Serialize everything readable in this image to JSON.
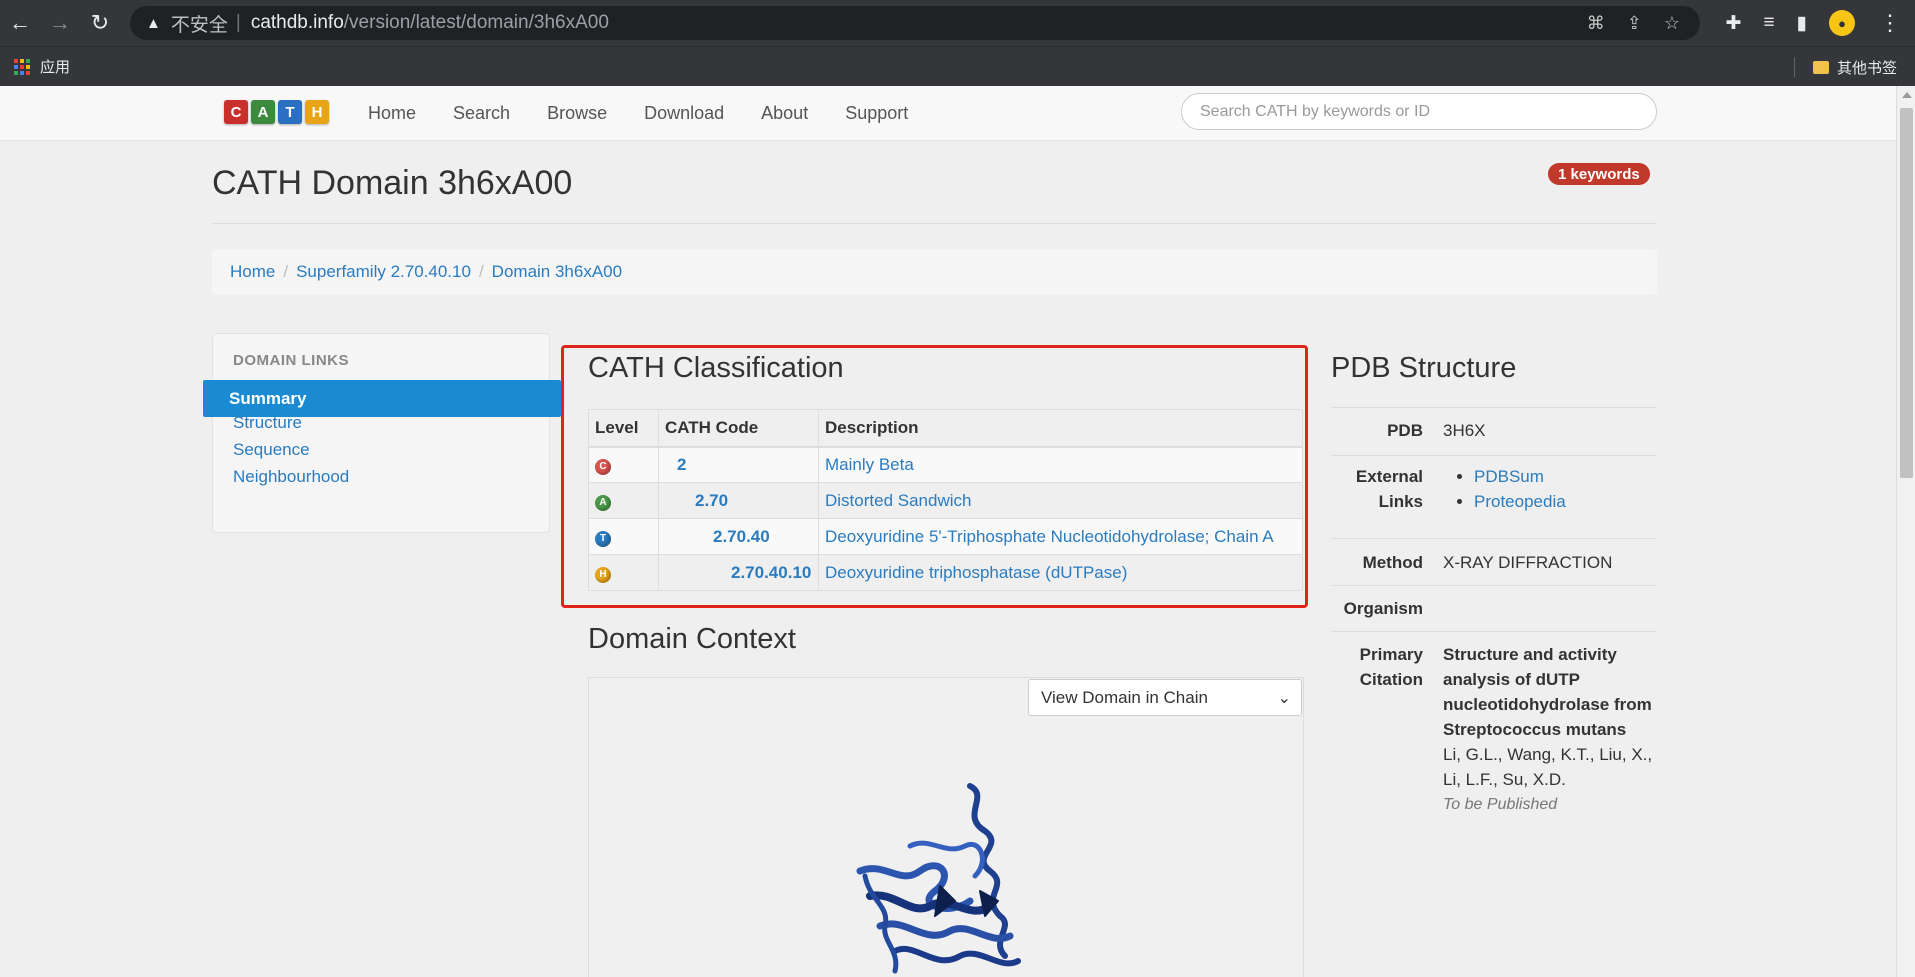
{
  "browser": {
    "security_label": "不安全",
    "url_host": "cathdb.info",
    "url_path": "/version/latest/domain/3h6xA00",
    "bookmarks_apps": "应用",
    "bookmarks_other": "其他书签"
  },
  "site": {
    "logo_letters": [
      "C",
      "A",
      "T",
      "H"
    ],
    "logo_colors": [
      "#c9302c",
      "#3c8a3c",
      "#2a6fc0",
      "#e8a319"
    ],
    "nav": [
      "Home",
      "Search",
      "Browse",
      "Download",
      "About",
      "Support"
    ],
    "search_placeholder": "Search CATH by keywords or ID"
  },
  "page": {
    "title": "CATH Domain 3h6xA00",
    "keywords_badge": "1 keywords"
  },
  "breadcrumb": [
    "Home",
    "Superfamily 2.70.40.10",
    "Domain 3h6xA00"
  ],
  "sidebar": {
    "heading": "DOMAIN LINKS",
    "active": "Summary",
    "links": [
      "Structure",
      "Sequence",
      "Neighbourhood"
    ]
  },
  "classification": {
    "title": "CATH Classification",
    "headers": [
      "Level",
      "CATH Code",
      "Description"
    ],
    "rows": [
      {
        "level": "C",
        "level_color": "#d9534f",
        "code": "2",
        "description": "Mainly Beta"
      },
      {
        "level": "A",
        "level_color": "#4a9a4a",
        "code": "2.70",
        "description": "Distorted Sandwich"
      },
      {
        "level": "T",
        "level_color": "#2a7bbf",
        "code": "2.70.40",
        "description": "Deoxyuridine 5'-Triphosphate Nucleotidohydrolase; Chain A"
      },
      {
        "level": "H",
        "level_color": "#e8a319",
        "code": "2.70.40.10",
        "description": "Deoxyuridine triphosphatase (dUTPase)"
      }
    ]
  },
  "context": {
    "title": "Domain Context",
    "select_value": "View Domain in Chain"
  },
  "pdb": {
    "title": "PDB Structure",
    "pdb_label": "PDB",
    "pdb_value": "3H6X",
    "external_label_1": "External",
    "external_label_2": "Links",
    "external_links": [
      "PDBSum",
      "Proteopedia"
    ],
    "method_label": "Method",
    "method_value": "X-RAY DIFFRACTION",
    "organism_label": "Organism",
    "citation_label_1": "Primary",
    "citation_label_2": "Citation",
    "citation_title_lines": [
      "Structure and activity",
      "analysis of dUTP",
      "nucleotidohydrolase from",
      "Streptococcus mutans"
    ],
    "citation_authors_lines": [
      "Li, G.L., Wang, K.T., Liu, X.,",
      "Li, L.F., Su, X.D."
    ],
    "citation_status": "To be Published"
  }
}
